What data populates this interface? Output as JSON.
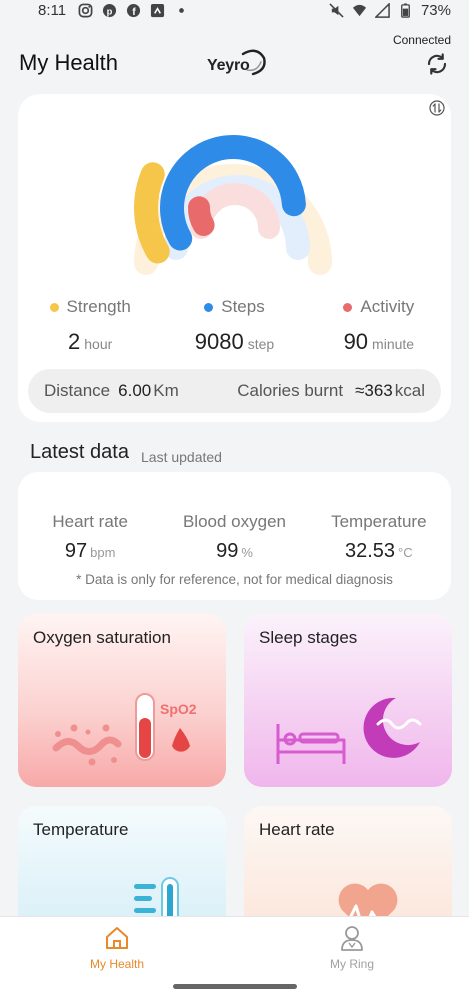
{
  "status_bar": {
    "time": "8:11",
    "battery": "73%",
    "left_icons": [
      "instagram-icon",
      "pinterest-icon",
      "facebook-icon",
      "app-notification-icon",
      "dot-icon"
    ],
    "right_icons": [
      "mute-icon",
      "wifi-icon",
      "signal-icon",
      "battery-icon"
    ]
  },
  "header": {
    "title": "My Health",
    "logo_text": "Yeyro",
    "connection_status": "Connected"
  },
  "activity": {
    "rings": [
      {
        "name": "Steps",
        "progress": 0.86,
        "color": "#2f8be8"
      },
      {
        "name": "Strength",
        "progress": 0.22,
        "color": "#f5c64a"
      },
      {
        "name": "Activity",
        "progress": 0.13,
        "color": "#e86a6a"
      }
    ],
    "metrics": [
      {
        "label": "Strength",
        "value": "2",
        "unit": "hour",
        "color": "#f5c64a"
      },
      {
        "label": "Steps",
        "value": "9080",
        "unit": "step",
        "color": "#2f8be8"
      },
      {
        "label": "Activity",
        "value": "90",
        "unit": "minute",
        "color": "#e86a6a"
      }
    ],
    "distance_label": "Distance",
    "distance_value": "6.00",
    "distance_unit": "Km",
    "calories_label": "Calories burnt",
    "calories_value": "≈363",
    "calories_unit": "kcal"
  },
  "latest": {
    "title": "Latest data",
    "subtitle": "Last updated",
    "vitals": [
      {
        "label": "Heart rate",
        "value": "97",
        "unit": "bpm"
      },
      {
        "label": "Blood oxygen",
        "value": "99",
        "unit": "%"
      },
      {
        "label": "Temperature",
        "value": "32.53",
        "unit": "°C"
      }
    ],
    "disclaimer": "* Data is only for reference, not for medical diagnosis"
  },
  "tiles": [
    {
      "title": "Oxygen saturation",
      "badge": "SpO2"
    },
    {
      "title": "Sleep stages"
    },
    {
      "title": "Temperature"
    },
    {
      "title": "Heart rate"
    }
  ],
  "nav": {
    "items": [
      {
        "label": "My Health",
        "active": true
      },
      {
        "label": "My Ring",
        "active": false
      }
    ]
  },
  "colors": {
    "accent": "#e8892b",
    "steps": "#2f8be8",
    "strength": "#f5c64a",
    "activity": "#e86a6a"
  }
}
